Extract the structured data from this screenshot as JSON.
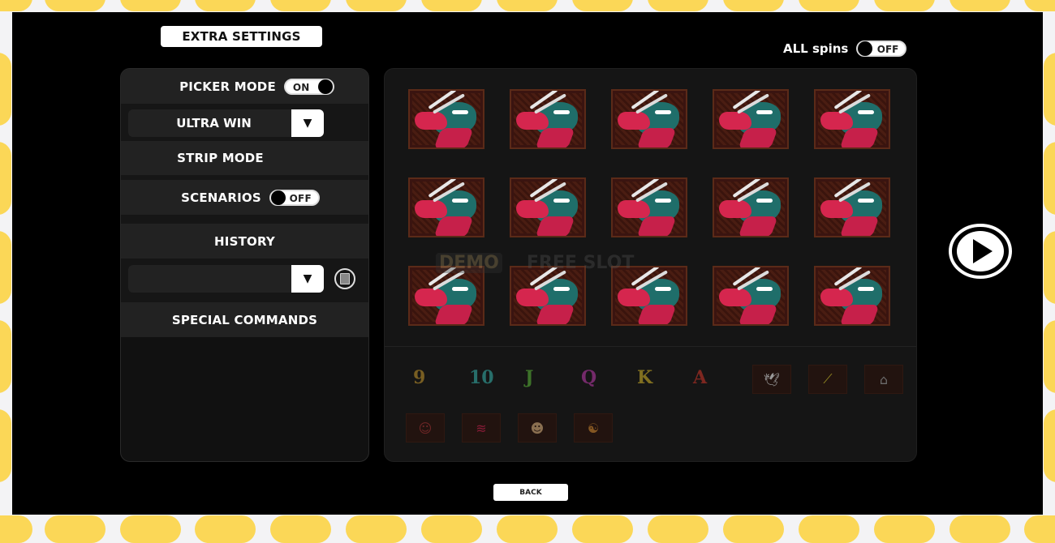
{
  "header": {
    "title": "EXTRA SETTINGS",
    "all_spins": {
      "label": "ALL spins",
      "state": "OFF"
    }
  },
  "left_panel": {
    "picker_mode": {
      "label": "PICKER MODE",
      "state": "ON"
    },
    "win_select": {
      "value": "ULTRA WIN",
      "arrow": "▼"
    },
    "strip_mode": {
      "label": "STRIP MODE"
    },
    "scenarios": {
      "label": "SCENARIOS",
      "state": "OFF"
    },
    "history": {
      "label": "HISTORY"
    },
    "history_select": {
      "value": "",
      "arrow": "▼"
    },
    "special_commands": {
      "label": "SPECIAL COMMANDS"
    }
  },
  "reels": {
    "rows": 3,
    "cols": 5,
    "symbol": "dragon",
    "watermark": {
      "left": "DEMO",
      "right": "FREE SLOT"
    }
  },
  "paytable": {
    "row1": [
      {
        "glyph": "9",
        "color": "#c99a2e"
      },
      {
        "glyph": "10",
        "color": "#37b7b0"
      },
      {
        "glyph": "J",
        "color": "#5fbf3a"
      },
      {
        "glyph": "Q",
        "color": "#c33cb0"
      },
      {
        "glyph": "K",
        "color": "#d8b92a"
      },
      {
        "glyph": "A",
        "color": "#d2362a"
      },
      {
        "glyph": "crane",
        "color": "#e0e0e0"
      },
      {
        "glyph": "chopsticks",
        "color": "#d8c82a"
      },
      {
        "glyph": "temple",
        "color": "#999999"
      }
    ],
    "row2": [
      {
        "glyph": "old-master",
        "color": "#a03030"
      },
      {
        "glyph": "dragon",
        "color": "#c6204a"
      },
      {
        "glyph": "fighter-scatter",
        "color": "#c9a070"
      },
      {
        "glyph": "yin-yang-wild",
        "color": "#c07a2a"
      }
    ]
  },
  "controls": {
    "play": "play",
    "back_label": "BACK"
  },
  "colors": {
    "frame_yellow": "#fbd757",
    "panel": "#111111",
    "row_light": "#222222"
  }
}
